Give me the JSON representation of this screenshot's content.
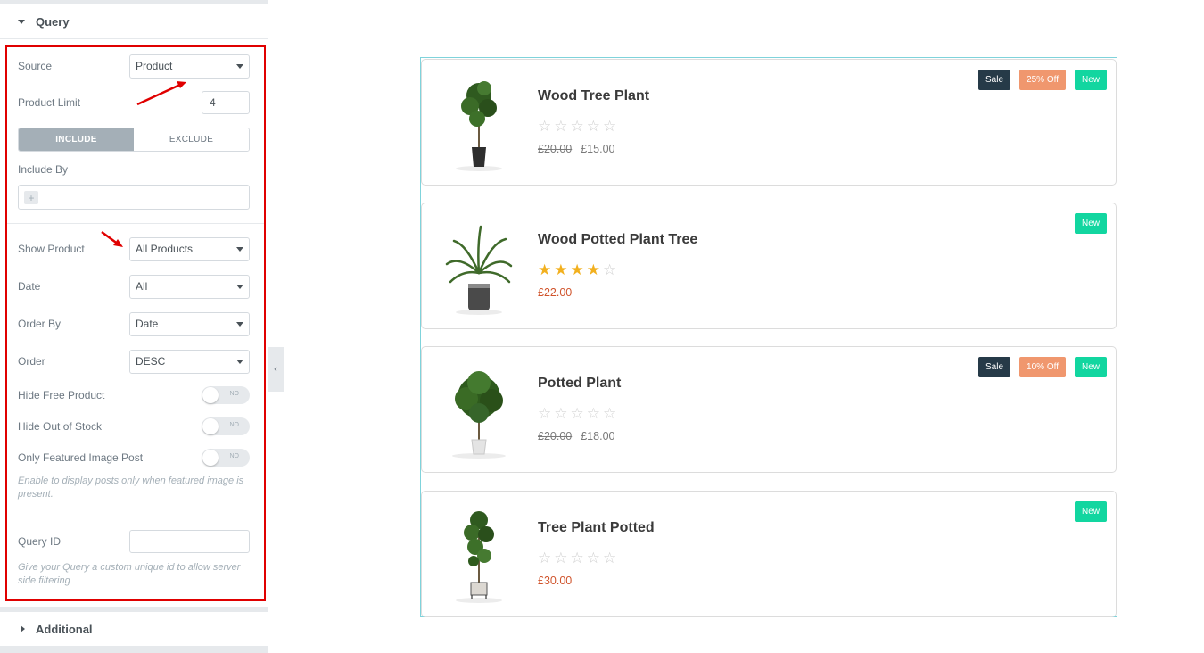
{
  "panel": {
    "query_title": "Query",
    "additional_title": "Additional",
    "source": {
      "label": "Source",
      "value": "Product"
    },
    "product_limit": {
      "label": "Product Limit",
      "value": "4"
    },
    "segment": {
      "include": "INCLUDE",
      "exclude": "EXCLUDE"
    },
    "include_by": {
      "label": "Include By",
      "add_symbol": "+"
    },
    "show_product": {
      "label": "Show Product",
      "value": "All Products"
    },
    "date": {
      "label": "Date",
      "value": "All"
    },
    "order_by": {
      "label": "Order By",
      "value": "Date"
    },
    "order": {
      "label": "Order",
      "value": "DESC"
    },
    "hide_free": {
      "label": "Hide Free Product",
      "state": "NO"
    },
    "hide_out_of_stock": {
      "label": "Hide Out of Stock",
      "state": "NO"
    },
    "only_featured": {
      "label": "Only Featured Image Post",
      "state": "NO"
    },
    "featured_hint": "Enable to display posts only when featured image is present.",
    "query_id": {
      "label": "Query ID",
      "value": ""
    },
    "query_hint": "Give your Query a custom unique id to allow server side filtering",
    "collapse_icon": "chevron-left-icon",
    "highlight_color": "#e00000"
  },
  "products": [
    {
      "name": "Wood Tree Plant",
      "rating": 0,
      "old_price": "£20.00",
      "price": "£15.00",
      "badges": [
        "Sale",
        "25% Off",
        "New"
      ]
    },
    {
      "name": "Wood Potted Plant Tree",
      "rating": 4,
      "old_price": "",
      "price": "£22.00",
      "badges": [
        "New"
      ]
    },
    {
      "name": "Potted Plant",
      "rating": 0,
      "old_price": "£20.00",
      "price": "£18.00",
      "badges": [
        "Sale",
        "10% Off",
        "New"
      ]
    },
    {
      "name": "Tree Plant Potted",
      "rating": 0,
      "old_price": "",
      "price": "£30.00",
      "badges": [
        "New"
      ]
    }
  ],
  "colors": {
    "sale_badge": "#263a48",
    "off_badge": "#f0976e",
    "new_badge": "#12d6a0",
    "star": "#f2b01e",
    "sale_price": "#d0542c",
    "widget_border": "#7fd3db"
  }
}
